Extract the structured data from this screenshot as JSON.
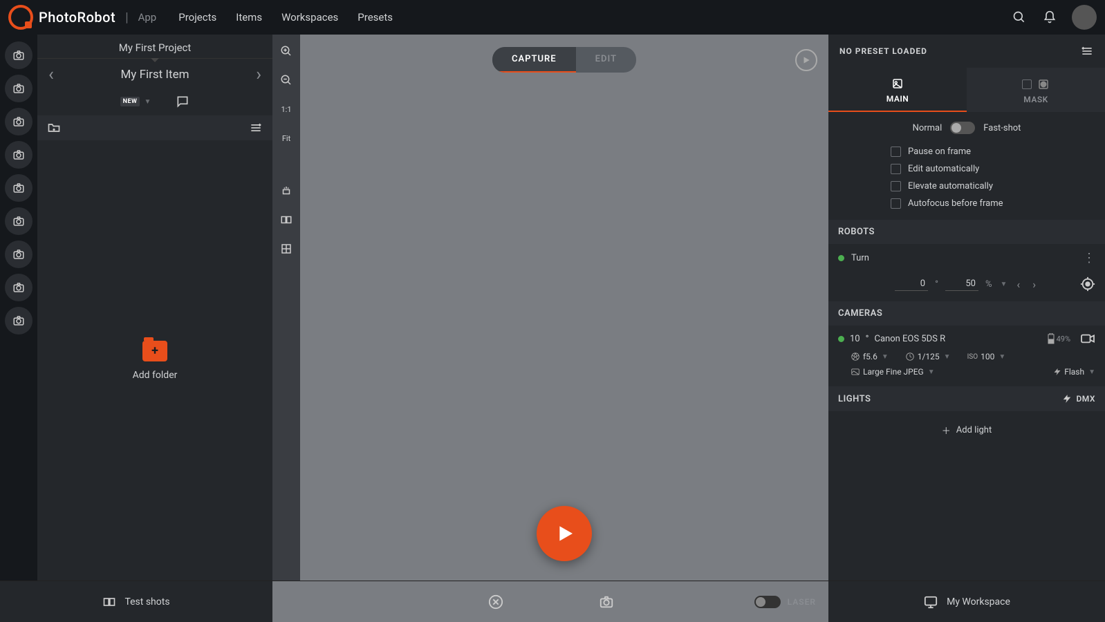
{
  "brand": {
    "name": "PhotoRobot",
    "app": "App"
  },
  "nav": {
    "projects": "Projects",
    "items": "Items",
    "workspaces": "Workspaces",
    "presets": "Presets"
  },
  "project": {
    "title": "My First Project"
  },
  "item": {
    "title": "My First Item",
    "badge": "NEW"
  },
  "folders": {
    "add_label": "Add folder"
  },
  "vstrip": {
    "ratio": "1:1",
    "fit": "Fit"
  },
  "mode": {
    "capture": "CAPTURE",
    "edit": "EDIT"
  },
  "right": {
    "preset": "NO PRESET LOADED",
    "tabs": {
      "main": "MAIN",
      "mask": "MASK"
    },
    "shot_mode": {
      "normal": "Normal",
      "fast": "Fast-shot"
    },
    "opts": {
      "pause": "Pause on frame",
      "edit_auto": "Edit automatically",
      "elevate_auto": "Elevate automatically",
      "autofocus": "Autofocus before frame"
    },
    "robots": {
      "header": "ROBOTS",
      "turn_name": "Turn",
      "angle_value": "0",
      "angle_unit": "°",
      "speed_value": "50",
      "speed_unit": "%"
    },
    "cameras": {
      "header": "CAMERAS",
      "id": "10",
      "separator": "°",
      "name": "Canon EOS 5DS R",
      "battery": "49%",
      "aperture": "f5.6",
      "shutter": "1/125",
      "iso_label": "ISO",
      "iso": "100",
      "quality": "Large Fine JPEG",
      "flash": "Flash"
    },
    "lights": {
      "header": "LIGHTS",
      "dmx": "DMX",
      "add": "Add light"
    }
  },
  "bottom": {
    "test_shots": "Test shots",
    "laser": "LASER",
    "workspace": "My Workspace"
  }
}
